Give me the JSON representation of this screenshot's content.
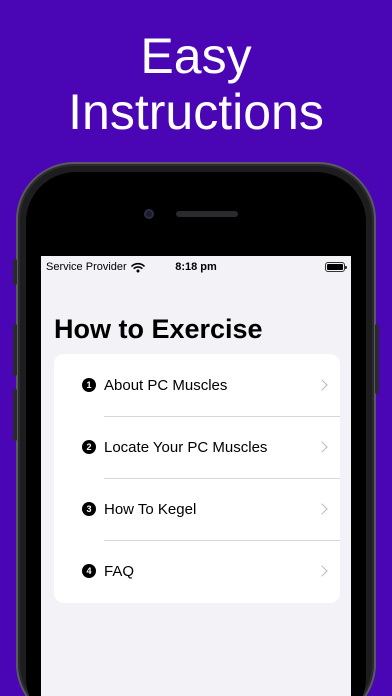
{
  "headline": {
    "line1": "Easy",
    "line2": "Instructions"
  },
  "status_bar": {
    "carrier": "Service Provider",
    "time": "8:18 pm"
  },
  "screen": {
    "title": "How to Exercise",
    "items": [
      {
        "number": "1",
        "label": "About PC Muscles"
      },
      {
        "number": "2",
        "label": "Locate Your PC Muscles"
      },
      {
        "number": "3",
        "label": "How To Kegel"
      },
      {
        "number": "4",
        "label": "FAQ"
      }
    ]
  },
  "colors": {
    "background": "#4a06b5",
    "screen": "#f2f2f7",
    "card": "#ffffff"
  }
}
